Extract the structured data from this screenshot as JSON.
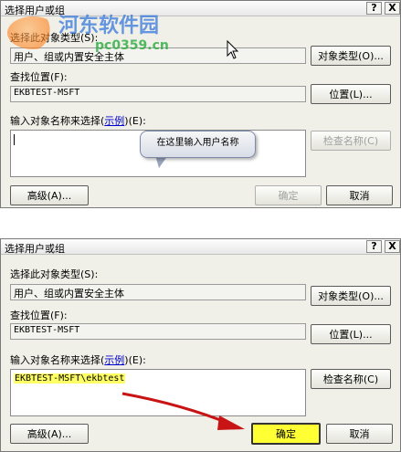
{
  "watermark": {
    "name": "河东软件园",
    "url": "pc0359.cn"
  },
  "colors": {
    "dialog_bg": "#f0f0e8",
    "link": "#0000cc",
    "highlight": "#ffff33",
    "arrow": "#c81414"
  },
  "dialog1": {
    "title": "选择用户或组",
    "help_button": "?",
    "close_button": "X",
    "object_type_label": "选择此对象类型(S):",
    "object_type_value": "用户、组或内置安全主体",
    "object_type_button": "对象类型(O)...",
    "location_label": "查找位置(F):",
    "location_value": "EKBTEST-MSFT",
    "location_button": "位置(L)...",
    "names_label": "输入对象名称来选择(",
    "names_label_link": "示例",
    "names_label_suffix": ")(E):",
    "check_names_button": "检查名称(C)",
    "tooltip": "在这里输入用户名称",
    "advanced_button": "高级(A)...",
    "ok_button": "确定",
    "cancel_button": "取消"
  },
  "dialog2": {
    "title": "选择用户或组",
    "help_button": "?",
    "close_button": "X",
    "object_type_label": "选择此对象类型(S):",
    "object_type_value": "用户、组或内置安全主体",
    "object_type_button": "对象类型(O)...",
    "location_label": "查找位置(F):",
    "location_value": "EKBTEST-MSFT",
    "location_button": "位置(L)...",
    "names_label": "输入对象名称来选择(",
    "names_label_link": "示例",
    "names_label_suffix": ")(E):",
    "names_value": "EKBTEST-MSFT\\ekbtest",
    "check_names_button": "检查名称(C)",
    "advanced_button": "高级(A)...",
    "ok_button": "确定",
    "cancel_button": "取消"
  }
}
